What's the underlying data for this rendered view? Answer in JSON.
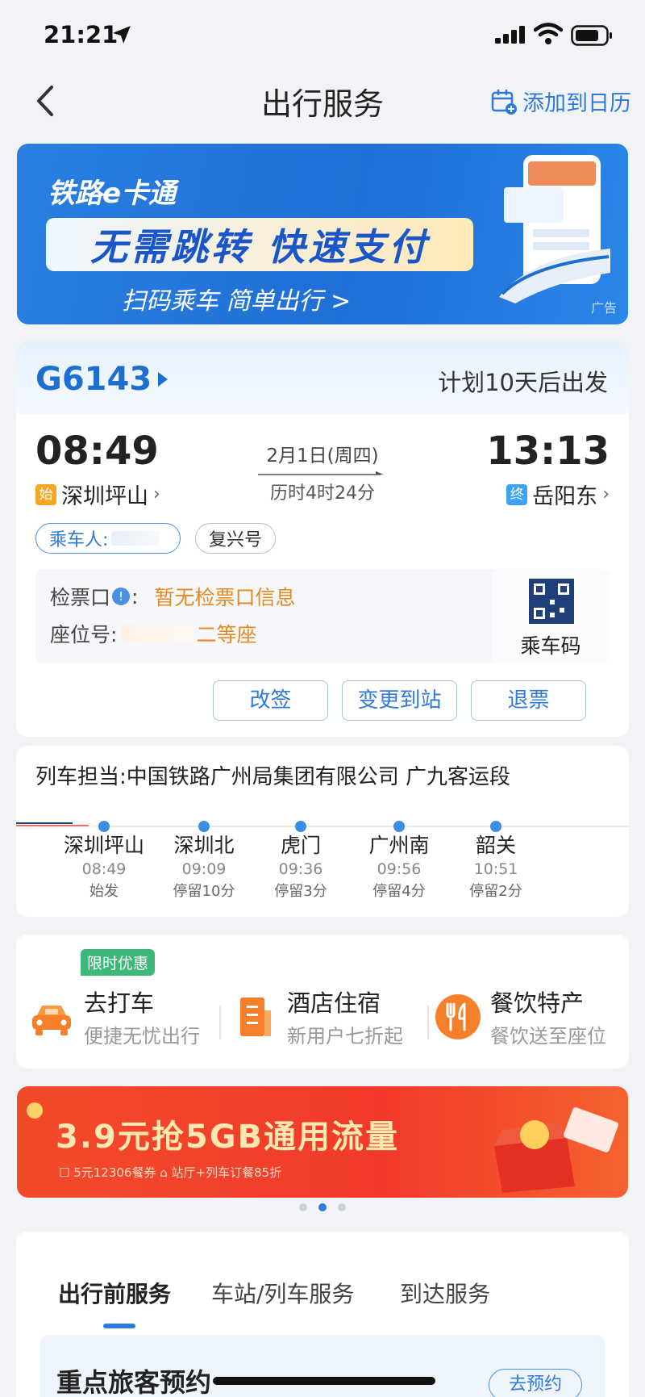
{
  "status_bar": {
    "time": "21:21"
  },
  "nav": {
    "title": "出行服务",
    "add_calendar": "添加到日历"
  },
  "banner": {
    "logo": "铁路e卡通",
    "slogan": "无需跳转 快速支付",
    "sub": "扫码乘车 简单出行 >",
    "ad_label": "广告"
  },
  "ticket": {
    "train_no": "G6143",
    "depart_info": "计划10天后出发",
    "dep_time": "08:49",
    "arr_time": "13:13",
    "dep_tag": "始",
    "arr_tag": "终",
    "dep_station": "深圳坪山",
    "arr_station": "岳阳东",
    "date": "2月1日(周四)",
    "duration": "历时4时24分",
    "passenger_label": "乘车人:",
    "train_type": "复兴号",
    "gate_label": "检票口",
    "gate_colon": ":",
    "gate_value": "暂无检票口信息",
    "seat_label": "座位号:",
    "seat_value": "二等座",
    "qr_label": "乘车码",
    "buttons": {
      "change": "改签",
      "change_station": "变更到站",
      "refund": "退票"
    }
  },
  "route": {
    "operator": "列车担当:中国铁路广州局集团有限公司 广九客运段",
    "stops": [
      {
        "name": "深圳坪山",
        "time": "08:49",
        "stay": "始发"
      },
      {
        "name": "深圳北",
        "time": "09:09",
        "stay": "停留10分"
      },
      {
        "name": "虎门",
        "time": "09:36",
        "stay": "停留3分"
      },
      {
        "name": "广州南",
        "time": "09:56",
        "stay": "停留4分"
      },
      {
        "name": "韶关",
        "time": "10:51",
        "stay": "停留2分"
      }
    ]
  },
  "services": {
    "promo_tag": "限时优惠",
    "items": [
      {
        "title": "去打车",
        "sub": "便捷无忧出行"
      },
      {
        "title": "酒店住宿",
        "sub": "新用户七折起"
      },
      {
        "title": "餐饮特产",
        "sub": "餐饮送至座位"
      }
    ]
  },
  "promo": {
    "title": "3.9元抢5GB通用流量",
    "sub": "☐ 5元12306餐券    ⌂ 站厅+列车订餐85折"
  },
  "tabs": {
    "items": [
      "出行前服务",
      "车站/列车服务",
      "到达服务"
    ],
    "active": 0
  },
  "sub_card": {
    "title": "重点旅客预约",
    "button": "去预约"
  },
  "colors": {
    "accent": "#2f7ad9",
    "orange": "#e58a1f",
    "promo_red": "#f34a2a",
    "green": "#3cb878"
  }
}
